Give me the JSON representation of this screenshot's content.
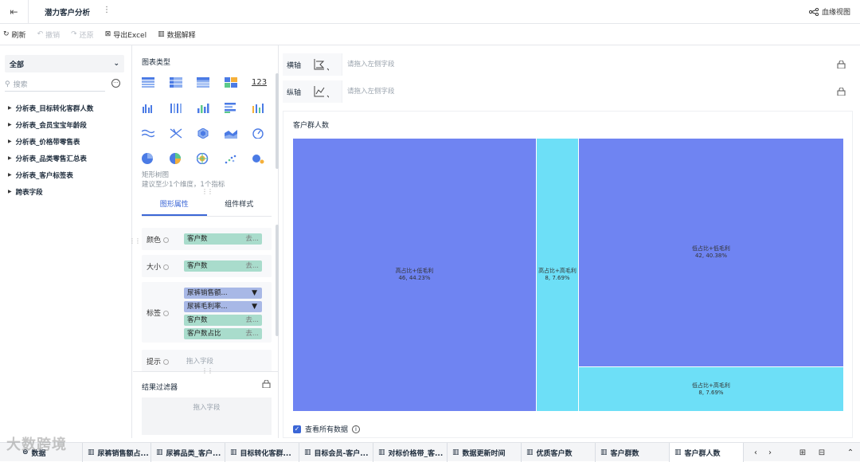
{
  "header": {
    "title": "潜力客户分析",
    "more": "⋮",
    "lineage": "血缘视图"
  },
  "toolbar": {
    "refresh": "刷新",
    "undo": "撤销",
    "redo": "还原",
    "export": "导出Excel",
    "explain": "数据解释"
  },
  "left": {
    "select": "全部",
    "search_placeholder": "搜索",
    "items": [
      "分析表_目标转化客群人数",
      "分析表_会员宝宝年龄段",
      "分析表_价格带零售表",
      "分析表_品类零售汇总表",
      "分析表_客户标签表",
      "跨表字段"
    ]
  },
  "mid": {
    "chart_type_title": "图表类型",
    "hint1": "矩形树图",
    "hint2": "建议至少1个维度，1个指标",
    "tabs": [
      "图形属性",
      "组件样式"
    ],
    "props": {
      "color_label": "颜色",
      "color_chip": "客户数",
      "size_label": "大小",
      "size_chip": "客户数",
      "label_label": "标签",
      "label_chips": [
        "尿裤销售额...",
        "尿裤毛利率...",
        "客户数",
        "客户数占比"
      ],
      "tip_label": "提示",
      "tip_placeholder": "拖入字段",
      "remove": "去..."
    },
    "filter_title": "结果过滤器",
    "filter_placeholder": "拖入字段"
  },
  "axes": {
    "x_label": "横轴",
    "y_label": "纵轴",
    "placeholder": "请拖入左侧字段"
  },
  "chart_data": {
    "type": "treemap",
    "title": "客户群人数",
    "nodes": [
      {
        "name": "高占比+低毛利",
        "value": 46,
        "pct": "44.23%",
        "color": "#6f84f2"
      },
      {
        "name": "高占比+高毛利",
        "value": 8,
        "pct": "7.69%",
        "color": "#6ddff7"
      },
      {
        "name": "低占比+低毛利",
        "value": 42,
        "pct": "40.38%",
        "color": "#6f84f2"
      },
      {
        "name": "低占比+高毛利",
        "value": 8,
        "pct": "7.69%",
        "color": "#6ddff7"
      }
    ]
  },
  "chart_texts": {
    "n0a": "高占比+低毛利",
    "n0b": "46, 44.23%",
    "n1a": "高占比+高毛利",
    "n1b": "8, 7.69%",
    "n2a": "低占比+低毛利",
    "n2b": "42, 40.38%",
    "n3a": "低占比+高毛利",
    "n3b": "8, 7.69%"
  },
  "view_all": "查看所有数据",
  "bottom_tabs": [
    "数据",
    "尿裤销售额占...",
    "尿裤品类_客户...",
    "目标转化客群...",
    "目标会员-客户...",
    "对标价格带_客...",
    "数据更新时间",
    "优质客户数",
    "客户群数",
    "客户群人数"
  ],
  "watermark": "大数跨境",
  "colors": {
    "accent": "#3b66d6",
    "chip_green": "#a9dccc",
    "chip_blue": "#a8b8e6"
  }
}
